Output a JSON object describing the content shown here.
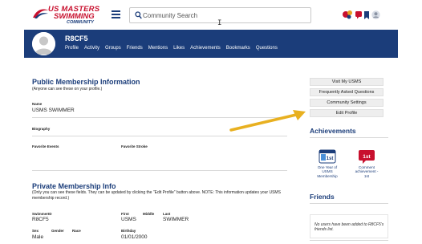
{
  "header": {
    "logo": {
      "line1": "US MASTERS",
      "line2": "SWIMMING",
      "line3": "COMMUNITY"
    },
    "search": {
      "placeholder": "Community Search",
      "value": ""
    },
    "icons": [
      "menu-icon",
      "search-icon",
      "notifications-icon",
      "messages-icon",
      "bookmark-icon",
      "user-avatar-icon"
    ]
  },
  "profile": {
    "username": "R8CF5",
    "nav": [
      "Profile",
      "Activity",
      "Groups",
      "Friends",
      "Mentions",
      "Likes",
      "Achievements",
      "Bookmarks",
      "Questions"
    ]
  },
  "public_info": {
    "title": "Public Membership Information",
    "subtitle": "(Anyone can see these on your profile.)",
    "name_label": "Name",
    "name_value": "USMS SWIMMER",
    "biography_label": "Biography",
    "favorite_events_label": "Favorite Events",
    "favorite_stroke_label": "Favorite Stroke"
  },
  "private_info": {
    "title": "Private Membership Info",
    "subtitle": "(Only you can see these fields. They can be updated by clicking the \"Edit Profile\" button above. NOTE: This information updates your USMS membership record.)",
    "swimmer_id_label": "SwimmerID",
    "swimmer_id_value": "R8CF5",
    "first_label": "First",
    "first_value": "USMS",
    "middle_label": "Middle",
    "last_label": "Last",
    "last_value": "SWIMMER",
    "sex_label": "Sex",
    "sex_value": "Male",
    "gender_label": "Gender",
    "race_label": "Race",
    "birthday_label": "Birthday",
    "birthday_value": "01/01/2000"
  },
  "sidebar": {
    "buttons": [
      "Visit My USMS",
      "Frequently Asked Questions",
      "Community Settings",
      "Edit Profile"
    ],
    "achievements_title": "Achievements",
    "achievements": [
      {
        "caption": "One Year of USMS Membership",
        "badge": "1st"
      },
      {
        "caption": "Comment achievement - 1st",
        "badge": "1st"
      }
    ],
    "friends_title": "Friends",
    "friends_message": "No users have been added to R8CF5's friends list."
  },
  "colors": {
    "navy": "#1b3d7a",
    "red": "#c8102e",
    "arrow": "#e8b020"
  }
}
